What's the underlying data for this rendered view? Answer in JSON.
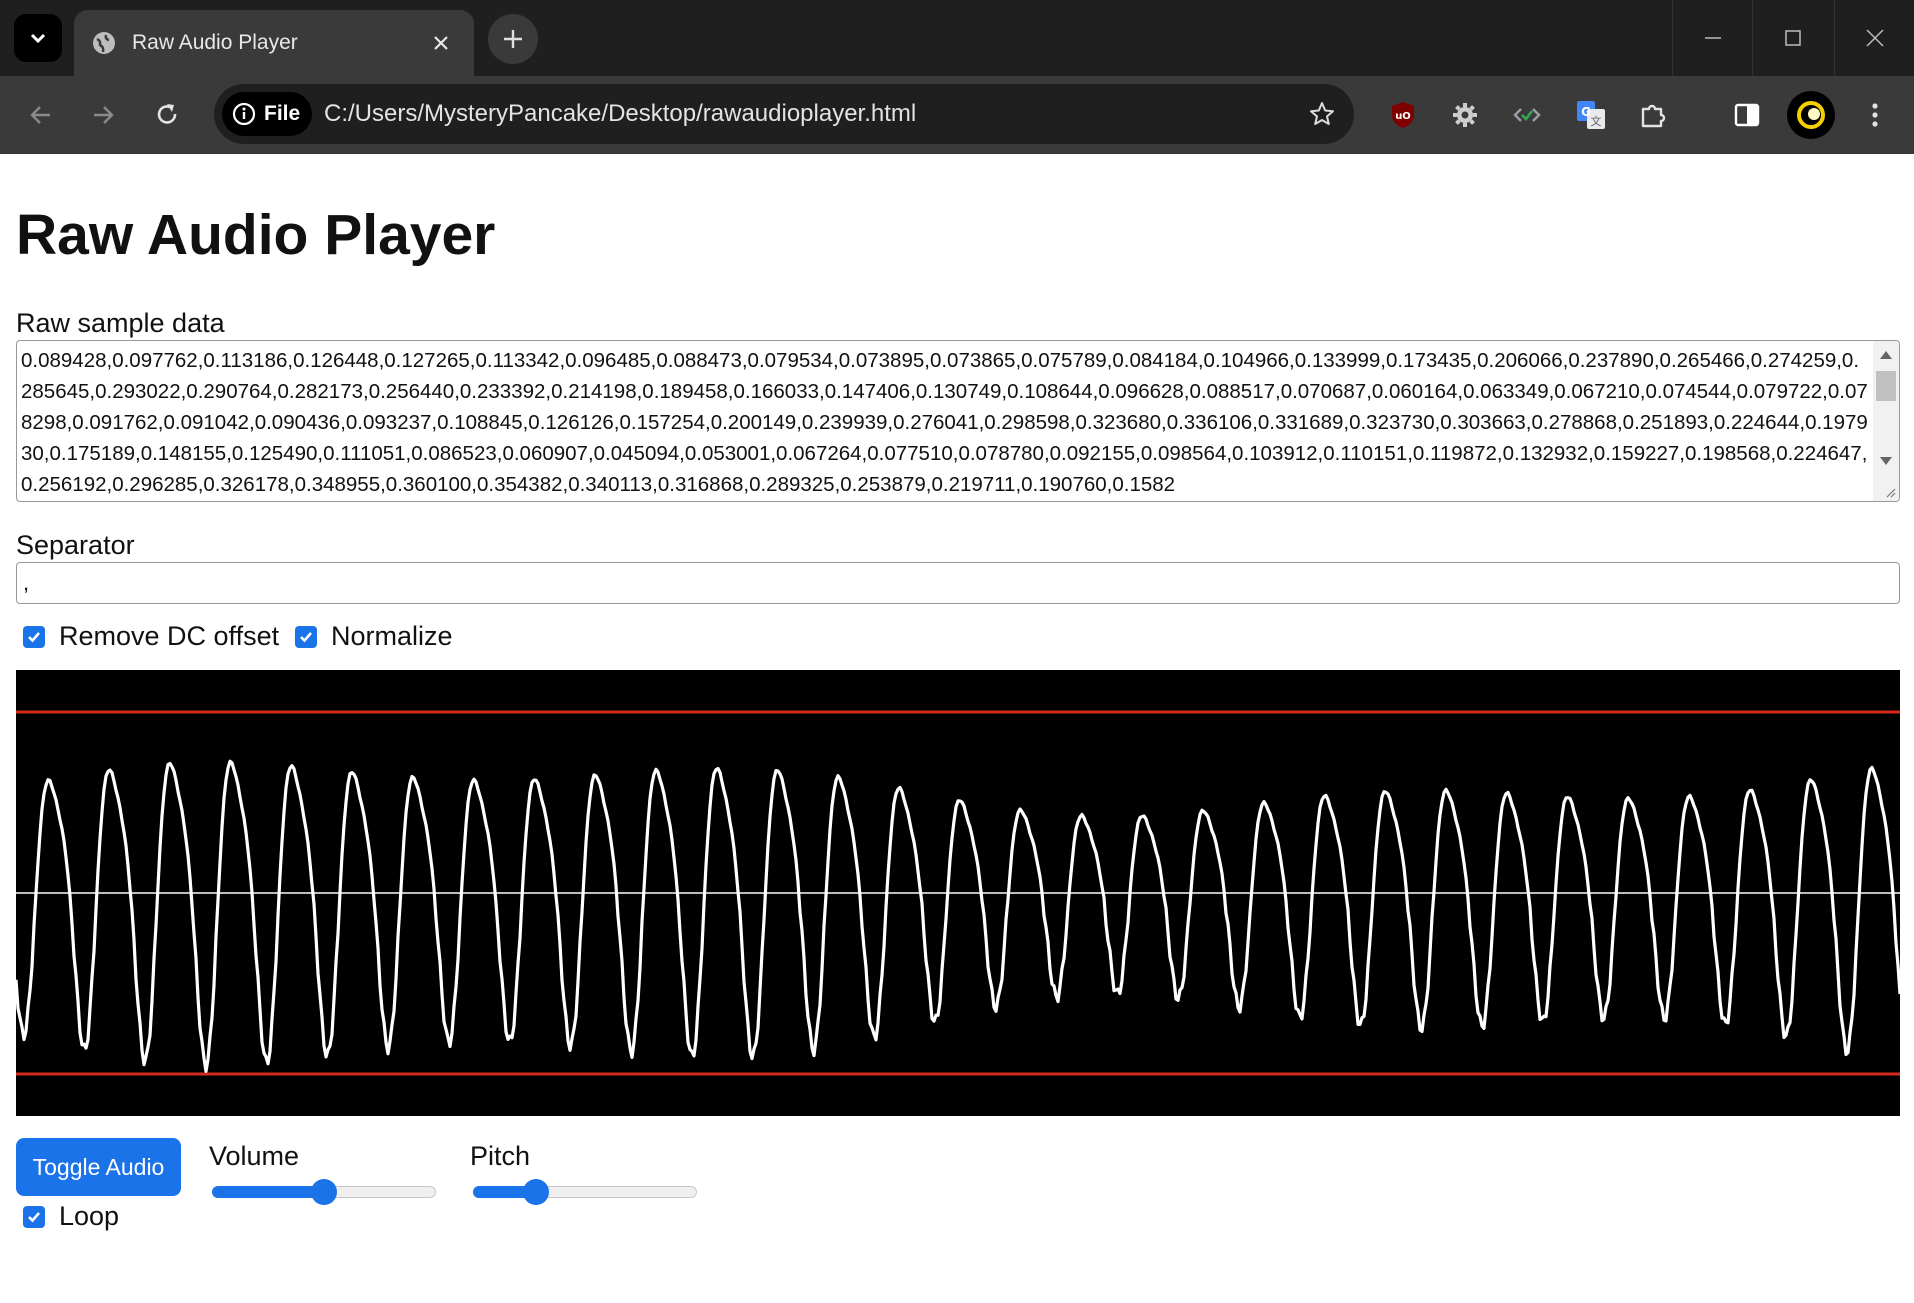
{
  "browser": {
    "tab_title": "Raw Audio Player",
    "file_chip": "File",
    "url": "C:/Users/MysteryPancake/Desktop/rawaudioplayer.html",
    "extensions": [
      "ublock-icon",
      "gear-icon",
      "code-icon",
      "translate-icon",
      "puzzle-icon",
      "sidepanel-icon",
      "profile-icon",
      "menu-icon"
    ]
  },
  "page": {
    "title": "Raw Audio Player",
    "raw_label": "Raw sample data",
    "raw_text": "0.089428,0.097762,0.113186,0.126448,0.127265,0.113342,0.096485,0.088473,0.079534,0.073895,0.073865,0.075789,0.084184,0.104966,0.133999,0.173435,0.206066,0.237890,0.265466,0.274259,0.285645,0.293022,0.290764,0.282173,0.256440,0.233392,0.214198,0.189458,0.166033,0.147406,0.130749,0.108644,0.096628,0.088517,0.070687,0.060164,0.063349,0.067210,0.074544,0.079722,0.078298,0.091762,0.091042,0.090436,0.093237,0.108845,0.126126,0.157254,0.200149,0.239939,0.276041,0.298598,0.323680,0.336106,0.331689,0.323730,0.303663,0.278868,0.251893,0.224644,0.197930,0.175189,0.148155,0.125490,0.111051,0.086523,0.060907,0.045094,0.053001,0.067264,0.077510,0.078780,0.092155,0.098564,0.103912,0.110151,0.119872,0.132932,0.159227,0.198568,0.224647,0.256192,0.296285,0.326178,0.348955,0.360100,0.354382,0.340113,0.316868,0.289325,0.253879,0.219711,0.190760,0.1582",
    "separator_label": "Separator",
    "separator_value": ",",
    "remove_dc_label": "Remove DC offset",
    "remove_dc_checked": true,
    "normalize_label": "Normalize",
    "normalize_checked": true,
    "toggle_label": "Toggle Audio",
    "loop_label": "Loop",
    "loop_checked": true,
    "volume_label": "Volume",
    "volume_value": 0.5,
    "pitch_label": "Pitch",
    "pitch_value": 0.28
  },
  "waveform": {
    "background": "#000000",
    "line_color": "#ffffff",
    "center_line_color": "#bdbdbd",
    "limit_line_color": "#d62a1e",
    "cycles": 31
  }
}
